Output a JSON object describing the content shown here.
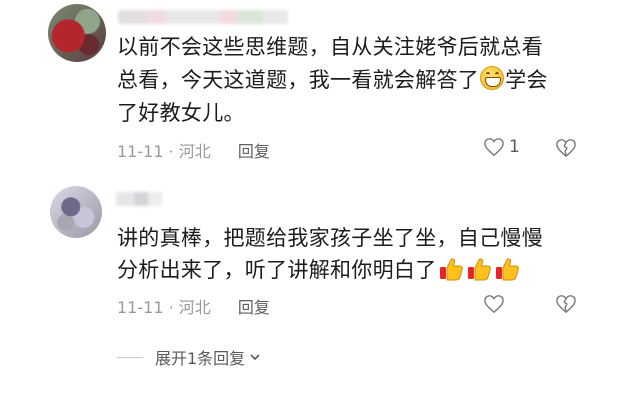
{
  "comments": [
    {
      "text_line1": "以前不会这些思维题，自从关注姥爷后就总看",
      "text_line2_part1": "总看，今天这道题，我一看就会解答了",
      "text_line2_part2": "学会",
      "text_line3": "了好教女儿。",
      "emoji": "grinning-face-icon",
      "date": "11-11",
      "location": "河北",
      "reply_label": "回复",
      "like_count": "1"
    },
    {
      "text_line1": "讲的真棒，把题给我家孩子坐了坐，自己慢慢",
      "text_line2": "分析出来了，听了讲解和你明白了",
      "emoji": "thumbs-up-icon",
      "emoji_count": 3,
      "date": "11-11",
      "location": "河北",
      "reply_label": "回复"
    }
  ],
  "expand_replies": {
    "label": "展开1条回复"
  },
  "colors": {
    "text": "#1c1c1c",
    "meta": "#9a9a9a",
    "reply": "#5f5f5f"
  }
}
